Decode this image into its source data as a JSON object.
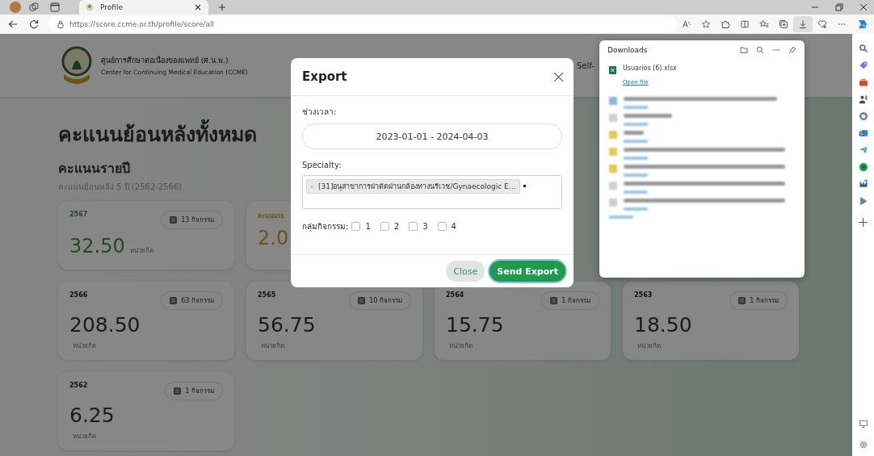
{
  "browser": {
    "tabs": [
      {
        "title": "Profile",
        "selected": true
      }
    ],
    "url": "https://score.ccme.or.th/profile/score/all",
    "toolbar": [
      {
        "kind": "read-aloud",
        "active": false
      },
      {
        "kind": "favorite",
        "active": false
      },
      {
        "kind": "extensions",
        "active": false
      },
      {
        "kind": "split",
        "active": false
      },
      {
        "kind": "favorites",
        "active": false
      },
      {
        "kind": "collections",
        "active": false
      },
      {
        "kind": "downloads",
        "active": true
      },
      {
        "kind": "health",
        "active": false
      },
      {
        "kind": "more",
        "active": false
      }
    ]
  },
  "header": {
    "org_name_th": "ศูนย์การศึกษาต่อเนื่องของแพทย์ (ศ.น.พ.)",
    "org_name_en": "Center for Continuing Medical Education (CCME)",
    "nav_item": "Self-"
  },
  "page": {
    "title": "คะแนนย้อนหลังทั้งหมด",
    "section_title": "คะแนนรายปี",
    "section_subtitle": "คะแนนย้อนหลัง 5 ปี (2562-2566)",
    "current_cards": [
      {
        "label": "2567",
        "activities": "13 กิจกรรม",
        "value": "32.50",
        "unit": "หน่วยกิต",
        "kind": "earned"
      },
      {
        "label": "คะแนนรอ",
        "value": "2.0",
        "kind": "pending"
      }
    ],
    "year_cards": [
      {
        "label": "2566",
        "activities": "63 กิจกรรม",
        "value": "208.50",
        "unit": "หน่วยกิต"
      },
      {
        "label": "2565",
        "activities": "10 กิจกรรม",
        "value": "56.75",
        "unit": "หน่วยกิต"
      },
      {
        "label": "2564",
        "activities": "1 กิจกรรม",
        "value": "15.75",
        "unit": "หน่วยกิต"
      },
      {
        "label": "2563",
        "activities": "1 กิจกรรม",
        "value": "18.50",
        "unit": "หน่วยกิต"
      },
      {
        "label": "2562",
        "activities": "1 กิจกรรม",
        "value": "6.25",
        "unit": "หน่วยกิต"
      }
    ]
  },
  "modal": {
    "title": "Export",
    "date_label": "ช่วงเวลา:",
    "date_range": "2023-01-01 - 2024-04-03",
    "specialty_label": "Specialty:",
    "specialty_tags": [
      "[31]อนุสาขาการผ่าตัดผ่านกล้องทางนรีเวช/Gynaecologic E…"
    ],
    "group_label": "กลุ่มกิจกรรม:",
    "groups": [
      {
        "label": "1",
        "checked": false
      },
      {
        "label": "2",
        "checked": false
      },
      {
        "label": "3",
        "checked": false
      },
      {
        "label": "4",
        "checked": false
      }
    ],
    "buttons": [
      {
        "label": "Close",
        "kind": "secondary"
      },
      {
        "label": "Send Export",
        "kind": "primary"
      }
    ]
  },
  "downloads": {
    "title": "Downloads",
    "items": [
      {
        "name": "Usuarios (6).xlsx",
        "action": "Open file"
      }
    ]
  }
}
